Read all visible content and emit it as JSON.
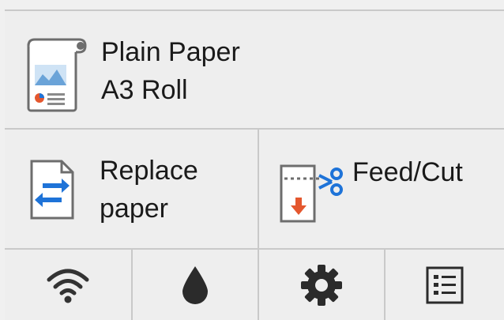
{
  "paper": {
    "type": "Plain Paper",
    "size": "A3 Roll"
  },
  "actions": {
    "replace_line1": "Replace",
    "replace_line2": "paper",
    "feed_cut": "Feed/Cut"
  },
  "bottom_bar": [
    {
      "icon": "wifi-icon"
    },
    {
      "icon": "ink-drop-icon"
    },
    {
      "icon": "gear-icon"
    },
    {
      "icon": "list-menu-icon"
    }
  ],
  "colors": {
    "background": "#eeeeee",
    "divider": "#c9c9c9",
    "accent_blue": "#1e73d8",
    "accent_orange": "#e4572e"
  }
}
